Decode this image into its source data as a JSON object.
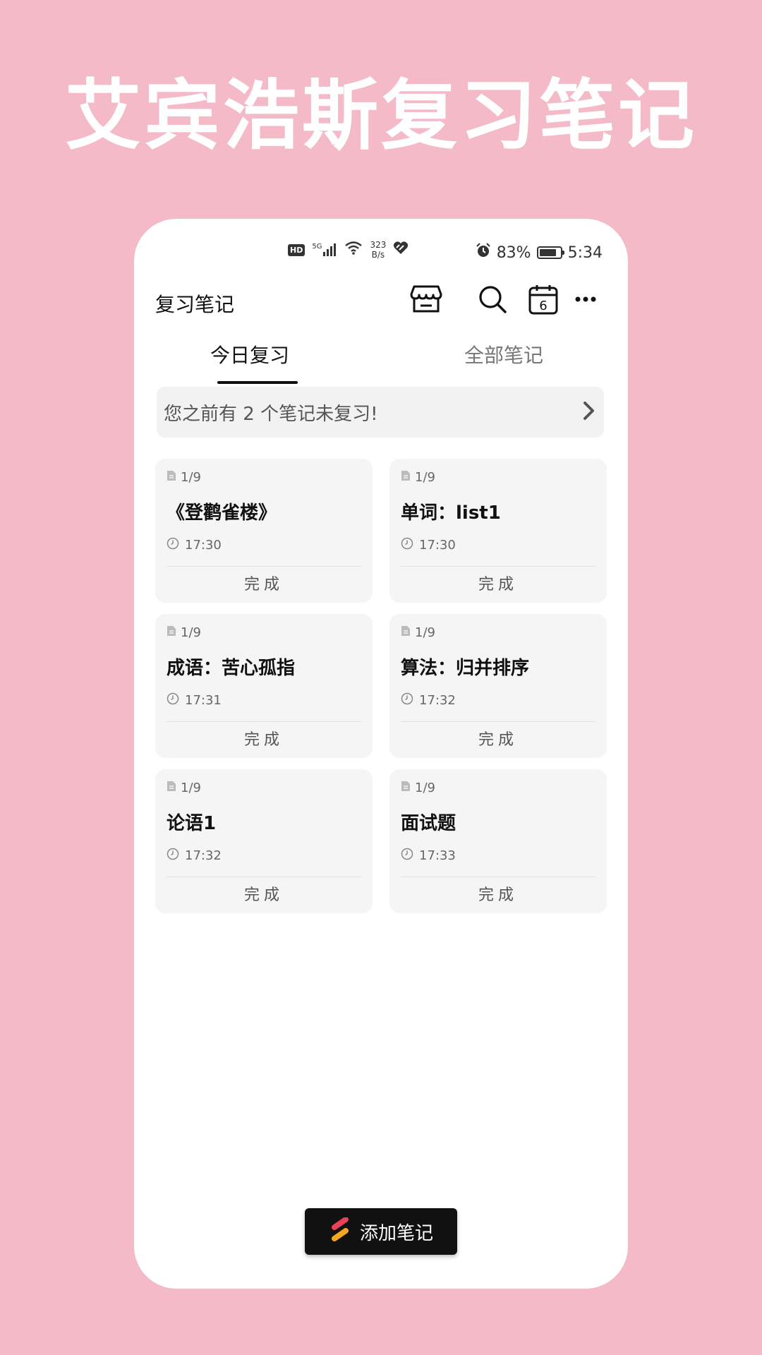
{
  "promo": {
    "title": "艾宾浩斯复习笔记"
  },
  "status_bar": {
    "network": "5G",
    "net_speed_value": "323",
    "net_speed_unit": "B/s",
    "battery": "83%",
    "battery_level": 0.83,
    "time": "5:34"
  },
  "app_bar": {
    "title": "复习笔记",
    "calendar_day": "6",
    "icons": [
      "store-icon",
      "search-icon",
      "calendar-icon",
      "more-icon"
    ]
  },
  "tabs": [
    {
      "label": "今日复习",
      "active": true
    },
    {
      "label": "全部笔记",
      "active": false
    }
  ],
  "notice": {
    "text": "您之前有 2 个笔记未复习!"
  },
  "notes": [
    {
      "count": "1/9",
      "title": "《登鹳雀楼》",
      "time": "17:30",
      "action": "完成"
    },
    {
      "count": "1/9",
      "title": "单词：list1",
      "time": "17:30",
      "action": "完成"
    },
    {
      "count": "1/9",
      "title": "成语：苦心孤指",
      "time": "17:31",
      "action": "完成"
    },
    {
      "count": "1/9",
      "title": "算法：归并排序",
      "time": "17:32",
      "action": "完成"
    },
    {
      "count": "1/9",
      "title": "论语1",
      "time": "17:32",
      "action": "完成"
    },
    {
      "count": "1/9",
      "title": "面试题",
      "time": "17:33",
      "action": "完成"
    }
  ],
  "add_button": {
    "label": "添加笔记"
  },
  "colors": {
    "background": "#f4bac8",
    "card": "#f5f5f5",
    "button": "#111111",
    "accent_orange": "#f5a623",
    "accent_red": "#e8415a"
  }
}
